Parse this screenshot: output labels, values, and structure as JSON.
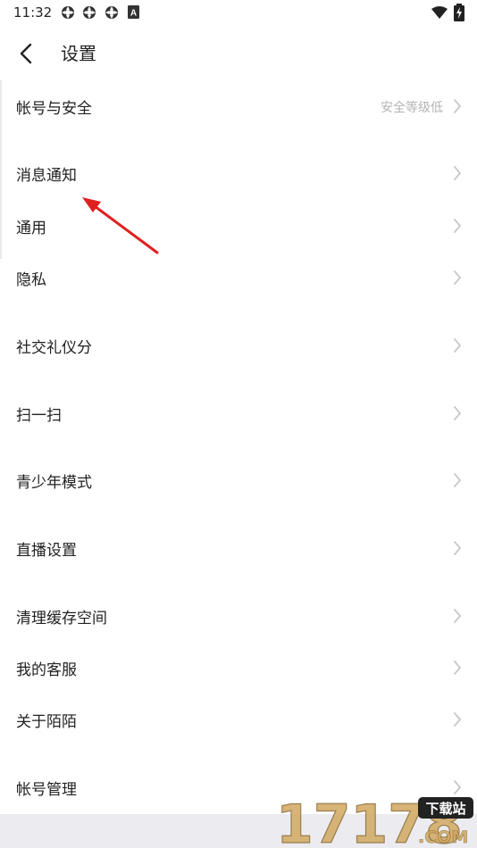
{
  "status_bar": {
    "time": "11:32",
    "notification_icons": [
      "notification-app-icon",
      "notification-app-icon",
      "notification-app-icon",
      "notification-a-icon"
    ],
    "a_badge": "A",
    "system_icons": [
      "wifi-icon",
      "battery-charging-icon"
    ]
  },
  "header": {
    "back_icon": "chevron-left-icon",
    "title": "设置"
  },
  "settings": {
    "items": [
      {
        "label": "帐号与安全",
        "value": "安全等级低"
      },
      {
        "label": "消息通知",
        "value": ""
      },
      {
        "label": "通用",
        "value": ""
      },
      {
        "label": "隐私",
        "value": ""
      },
      {
        "label": "社交礼仪分",
        "value": ""
      },
      {
        "label": "扫一扫",
        "value": ""
      },
      {
        "label": "青少年模式",
        "value": ""
      },
      {
        "label": "直播设置",
        "value": ""
      },
      {
        "label": "清理缓存空间",
        "value": ""
      },
      {
        "label": "我的客服",
        "value": ""
      },
      {
        "label": "关于陌陌",
        "value": ""
      },
      {
        "label": "帐号管理",
        "value": ""
      }
    ]
  },
  "annotation": {
    "arrow_color": "#e02020"
  },
  "watermark": {
    "number": "17178",
    "badge": "下载站",
    "domain": ".COM"
  },
  "colors": {
    "label": "#222222",
    "secondary": "#b4b4b4",
    "chevron": "#c8c8c8",
    "footer": "#ececf0"
  }
}
